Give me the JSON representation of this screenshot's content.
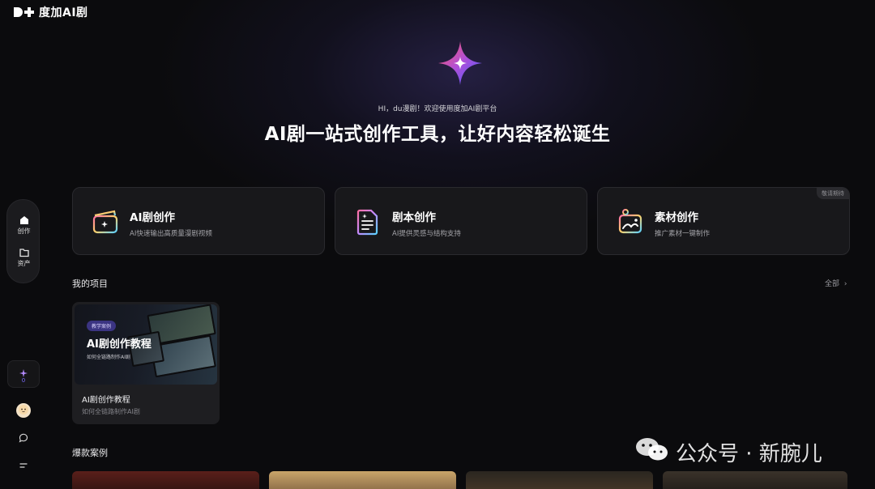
{
  "brand": {
    "logo_text": "度加AI剧"
  },
  "sidebar": {
    "items": [
      {
        "label": "创作",
        "icon": "home-icon",
        "active": true
      },
      {
        "label": "资产",
        "icon": "folder-icon",
        "active": false
      }
    ],
    "credits": {
      "value": "0",
      "icon": "sparkle-icon"
    },
    "avatar_icon": "avatar-icon",
    "bottom_icons": [
      "chat-icon",
      "menu-icon"
    ]
  },
  "hero": {
    "greeting": "HI，du漫剧！欢迎使用度加AI剧平台",
    "headline": "AI剧一站式创作工具，让好内容轻松诞生"
  },
  "cards": [
    {
      "title": "AI剧创作",
      "desc": "AI快速输出高质量漫剧视频",
      "icon": "clapperboard-icon",
      "badge": ""
    },
    {
      "title": "剧本创作",
      "desc": "AI提供灵感与结构支持",
      "icon": "script-document-icon",
      "badge": ""
    },
    {
      "title": "素材创作",
      "desc": "推广素材一键制作",
      "icon": "asset-image-icon",
      "badge": "敬请期待"
    }
  ],
  "projects": {
    "title": "我的项目",
    "all_label": "全部",
    "items": [
      {
        "thumb_tag": "教学案例",
        "thumb_title": "AI剧创作教程",
        "thumb_subtitle": "如何全链路制作AI剧",
        "name": "AI剧创作教程",
        "subtitle": "如何全链路制作AI剧"
      }
    ]
  },
  "cases": {
    "title": "爆款案例"
  },
  "watermark": {
    "text": "公众号 · 新腕儿"
  },
  "colors": {
    "accent": "#7b6cff",
    "background": "#0b0b0d",
    "card": "#18181b"
  }
}
